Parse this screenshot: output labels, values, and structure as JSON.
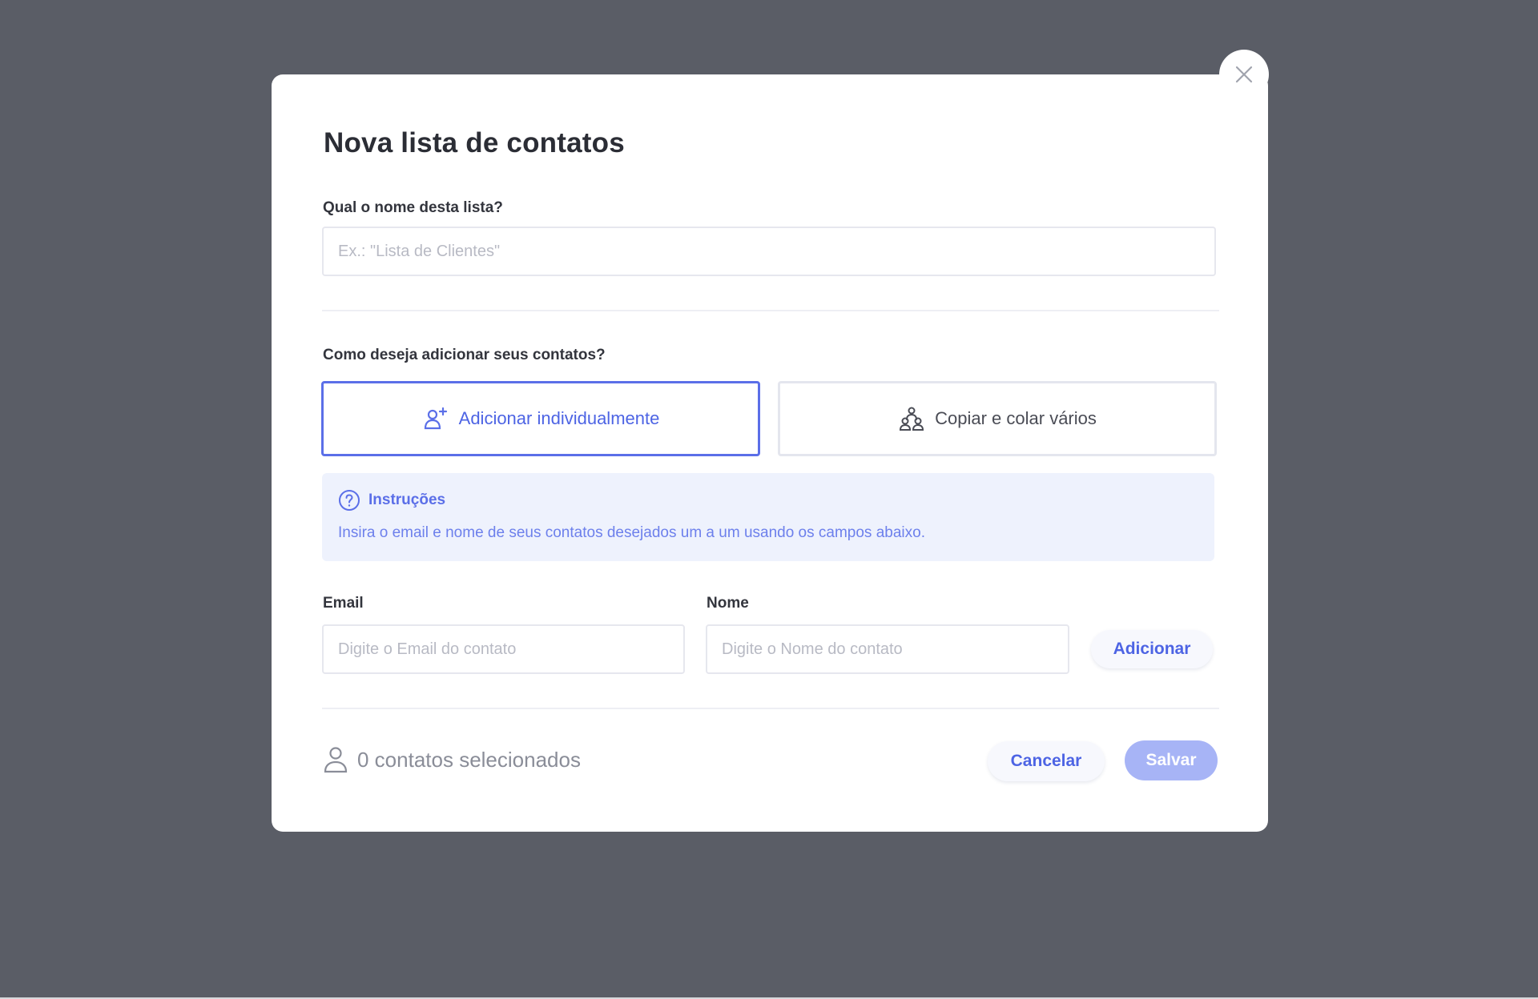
{
  "modal": {
    "title": "Nova lista de contatos",
    "list_name": {
      "label": "Qual o nome desta lista?",
      "placeholder": "Ex.: \"Lista de Clientes\"",
      "value": ""
    },
    "add_method": {
      "label": "Como deseja adicionar seus contatos?",
      "options": [
        {
          "label": "Adicionar individualmente",
          "icon": "add-user-icon",
          "selected": true
        },
        {
          "label": "Copiar e colar vários",
          "icon": "group-icon",
          "selected": false
        }
      ]
    },
    "instructions": {
      "title": "Instruções",
      "icon": "help-circle-icon",
      "text": "Insira o email e nome de seus contatos desejados um a um usando os campos abaixo."
    },
    "contact_form": {
      "email_label": "Email",
      "email_placeholder": "Digite o Email do contato",
      "name_label": "Nome",
      "name_placeholder": "Digite o Nome do contato",
      "add_button": "Adicionar"
    },
    "footer": {
      "count_text": "0 contatos selecionados",
      "cancel_button": "Cancelar",
      "save_button": "Salvar"
    }
  },
  "colors": {
    "overlay": "#5a5d66",
    "accent": "#5b6fe8",
    "primary_disabled": "#a7b4f6",
    "info_background": "#eef2fd"
  }
}
